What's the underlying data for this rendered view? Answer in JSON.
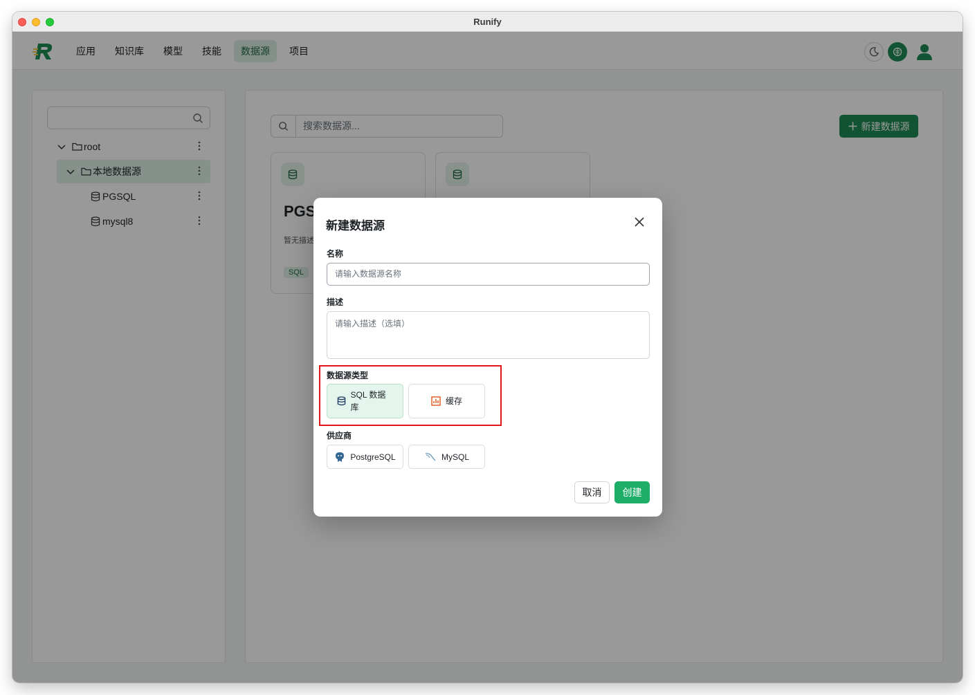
{
  "window": {
    "title": "Runify"
  },
  "nav": {
    "items": [
      {
        "label": "应用"
      },
      {
        "label": "知识库"
      },
      {
        "label": "模型"
      },
      {
        "label": "技能"
      },
      {
        "label": "数据源",
        "active": true
      },
      {
        "label": "项目"
      }
    ]
  },
  "tree": {
    "root": "root",
    "folder": "本地数据源",
    "items": [
      "PGSQL",
      "mysql8"
    ]
  },
  "main": {
    "search_placeholder": "搜索数据源...",
    "new_button": "新建数据源",
    "cards": [
      {
        "title": "PGS",
        "desc": "暂无描述",
        "tag": "SQL"
      }
    ]
  },
  "modal": {
    "title": "新建数据源",
    "name_label": "名称",
    "name_placeholder": "请输入数据源名称",
    "desc_label": "描述",
    "desc_placeholder": "请输入描述（选填）",
    "type_label": "数据源类型",
    "types": [
      {
        "label": "SQL 数据库",
        "selected": true,
        "icon": "database-icon"
      },
      {
        "label": "缓存",
        "selected": false,
        "icon": "bar-chart-icon"
      }
    ],
    "provider_label": "供应商",
    "providers": [
      {
        "label": "PostgreSQL",
        "icon": "postgresql-icon"
      },
      {
        "label": "MySQL",
        "icon": "mysql-icon"
      }
    ],
    "cancel": "取消",
    "create": "创建"
  },
  "colors": {
    "accent": "#1e8b55",
    "highlight": "#e1141c",
    "selected_bg": "#e3f5ec"
  }
}
